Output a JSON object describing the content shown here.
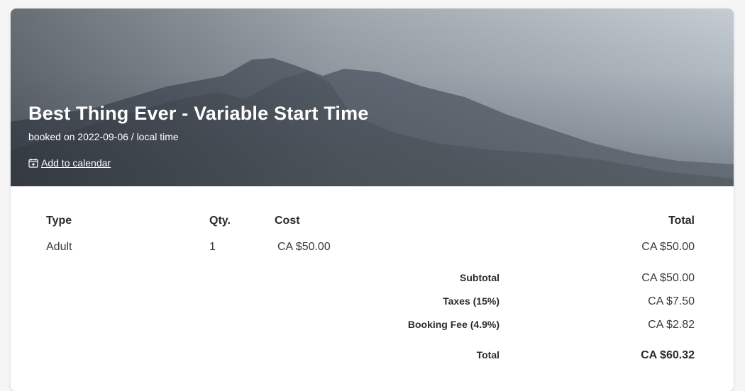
{
  "booking": {
    "title": "Best Thing Ever - Variable Start Time",
    "subtitle": "booked on 2022-09-06 / local time",
    "calendar_link": "Add to calendar"
  },
  "table": {
    "headers": {
      "type": "Type",
      "qty": "Qty.",
      "cost": "Cost",
      "total": "Total"
    },
    "rows": [
      {
        "type": "Adult",
        "qty": "1",
        "cost": "CA $50.00",
        "total": "CA $50.00"
      }
    ]
  },
  "summary": {
    "subtotal_label": "Subtotal",
    "subtotal_value": "CA $50.00",
    "taxes_label": "Taxes (15%)",
    "taxes_value": "CA $7.50",
    "fee_label": "Booking Fee (4.9%)",
    "fee_value": "CA $2.82",
    "total_label": "Total",
    "total_value": "CA $60.32"
  },
  "icons": {
    "calendar": "calendar-plus-icon"
  }
}
